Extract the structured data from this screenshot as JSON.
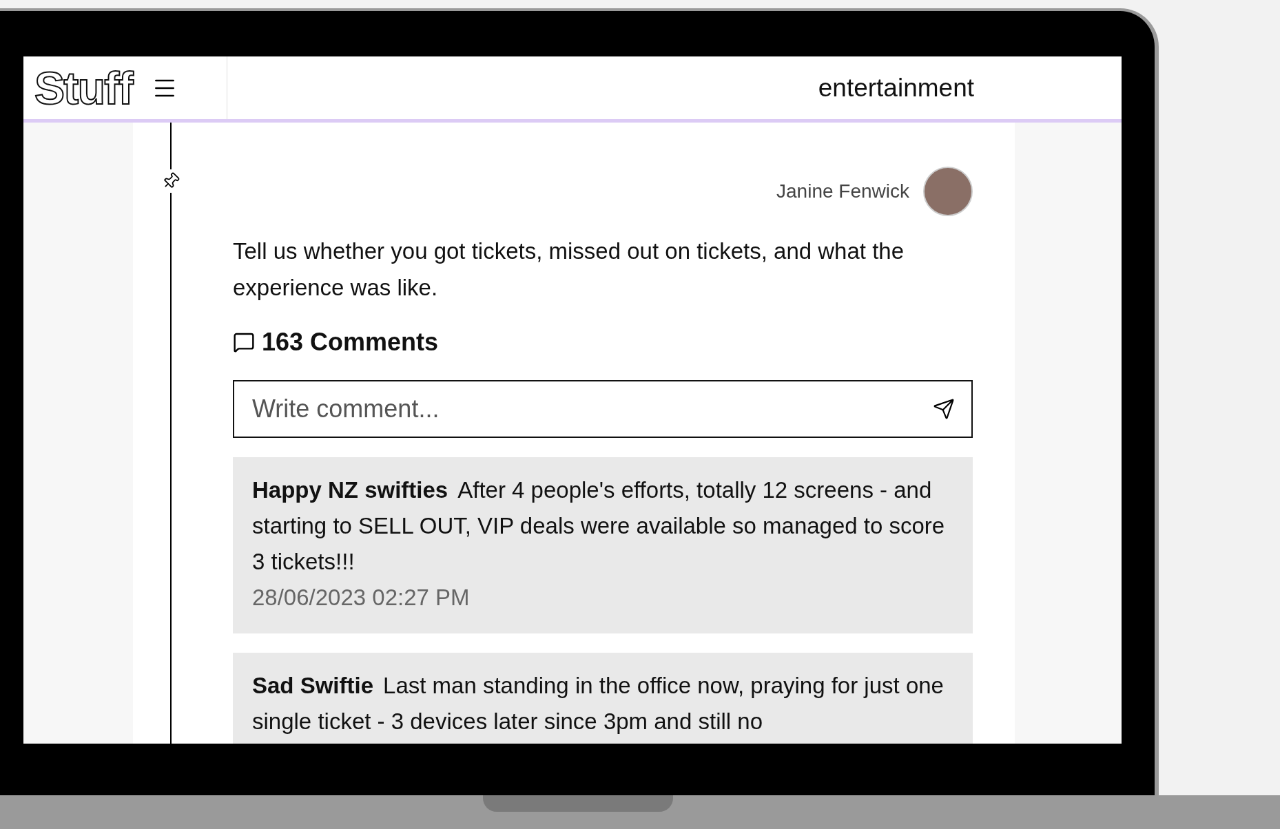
{
  "header": {
    "logo": "Stuff",
    "section": "entertainment"
  },
  "post": {
    "author": "Janine Fenwick",
    "text": "Tell us whether you got tickets, missed out on tickets, and what the experience was like.",
    "comments_count": "163 Comments",
    "comment_field": {
      "placeholder": "Write comment..."
    }
  },
  "comments": [
    {
      "author": "Happy NZ swifties",
      "text": "After 4 people's efforts, totally 12 screens - and starting to SELL OUT, VIP deals were available so managed to score 3 tickets!!!",
      "time": "28/06/2023 02:27 PM"
    },
    {
      "author": "Sad Swiftie",
      "text": "Last man standing in the office now, praying for just one single ticket - 3 devices later since 3pm and still no"
    }
  ]
}
